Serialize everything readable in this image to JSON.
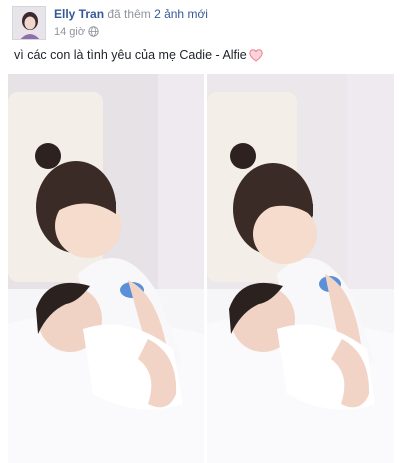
{
  "post": {
    "author_name": "Elly Tran",
    "action_text": "đã thêm",
    "photos_link": "2 ảnh mới",
    "timestamp": "14 giờ",
    "privacy_icon": "globe-icon",
    "caption": "vì các con là tình yêu của mẹ Cadie - Alfie",
    "caption_emoji": "heart-icon",
    "colors": {
      "link": "#365899",
      "meta": "#90949c",
      "heart": "#f27b8f"
    },
    "photos": [
      {
        "name": "photo-1",
        "alt": ""
      },
      {
        "name": "photo-2",
        "alt": ""
      }
    ]
  }
}
